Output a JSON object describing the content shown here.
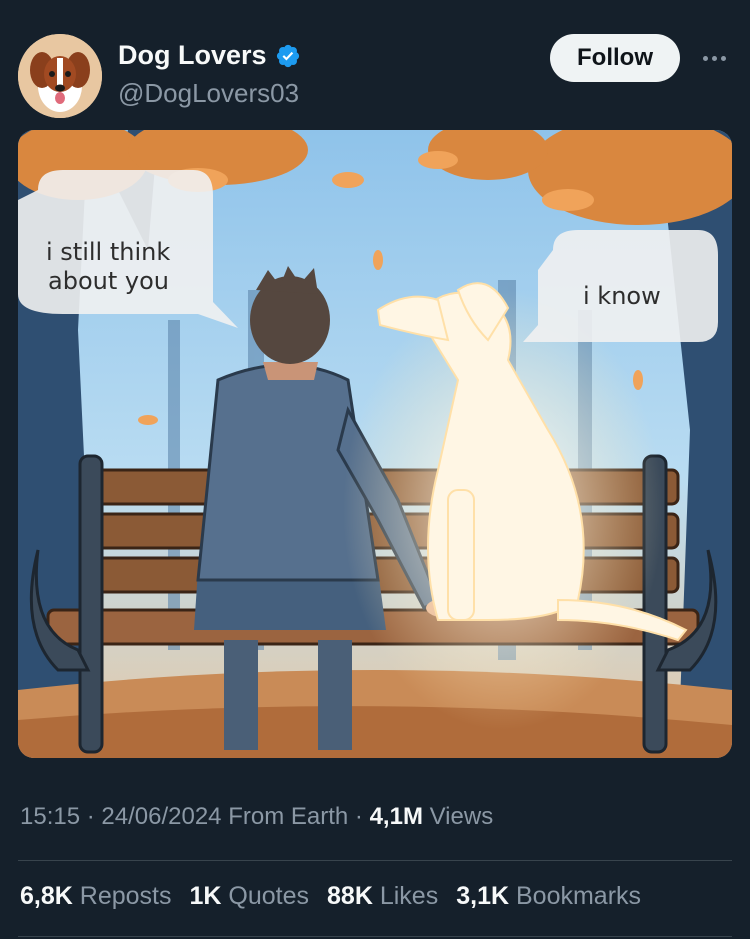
{
  "header": {
    "display_name": "Dog Lovers",
    "handle": "@DogLovers03",
    "follow_label": "Follow",
    "verified": true
  },
  "media": {
    "speech_left_line1": "i still think",
    "speech_left_line2": "about you",
    "speech_right": "i know"
  },
  "meta": {
    "time": "15:15",
    "date": "24/06/2024",
    "location": "From Earth",
    "views_count": "4,1M",
    "views_label": "Views",
    "separator": "·"
  },
  "stats": {
    "reposts_count": "6,8K",
    "reposts_label": "Reposts",
    "quotes_count": "1K",
    "quotes_label": "Quotes",
    "likes_count": "88K",
    "likes_label": "Likes",
    "bookmarks_count": "3,1K",
    "bookmarks_label": "Bookmarks"
  },
  "colors": {
    "background": "#15202b",
    "verified_badge": "#1d9bf0",
    "follow_button": "#eff3f4",
    "muted_text": "#8b98a5"
  }
}
